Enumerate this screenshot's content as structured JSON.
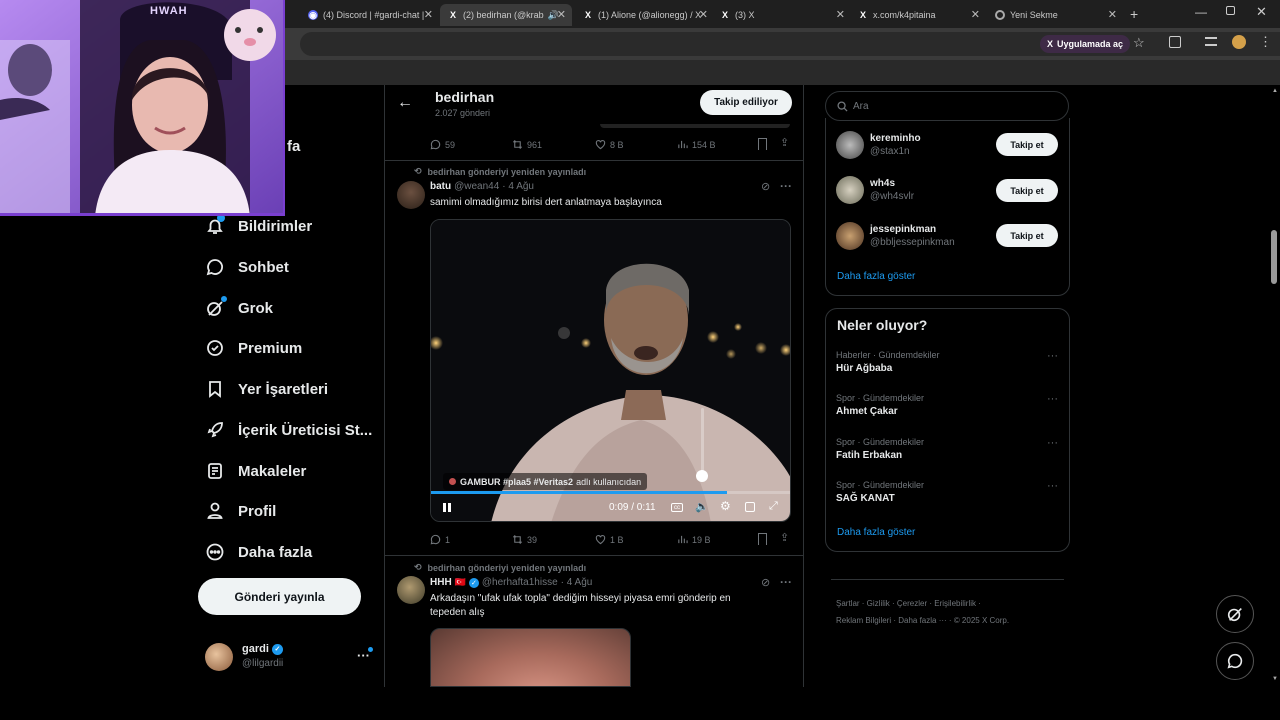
{
  "browser": {
    "tabs": [
      {
        "title": "(4) Discord | #gardi-chat |",
        "icon": "discord-icon"
      },
      {
        "title": "(2) bedirhan (@krab",
        "icon": "x-logo-icon",
        "active": true
      },
      {
        "title": "(1) Alione (@alionegg) / X",
        "icon": "x-logo-icon"
      },
      {
        "title": "(3) X",
        "icon": "x-logo-icon"
      },
      {
        "title": "x.com/k4pitaina",
        "icon": "x-logo-icon"
      },
      {
        "title": "Yeni Sekme",
        "icon": "chrome-icon"
      }
    ],
    "open_in_app": "Uygulamada aç"
  },
  "sidebar": {
    "partial_label": "fa",
    "items": [
      {
        "label": "Bildirimler",
        "icon": "bell-icon"
      },
      {
        "label": "Sohbet",
        "icon": "chat-icon"
      },
      {
        "label": "Grok",
        "icon": "grok-icon"
      },
      {
        "label": "Premium",
        "icon": "premium-icon"
      },
      {
        "label": "Yer İşaretleri",
        "icon": "bookmark-icon"
      },
      {
        "label": "İçerik Üreticisi St...",
        "icon": "rocket-icon"
      },
      {
        "label": "Makaleler",
        "icon": "article-icon"
      },
      {
        "label": "Profil",
        "icon": "person-icon"
      },
      {
        "label": "Daha fazla",
        "icon": "more-circle-icon"
      }
    ],
    "post_button": "Gönderi yayınla",
    "account": {
      "name": "gardi",
      "handle": "@lilgardii"
    }
  },
  "profile_header": {
    "name": "bedirhan",
    "posts_count": "2.027 gönderi",
    "follow_state": "Takip ediliyor"
  },
  "tweets": [
    {
      "stats": {
        "replies": "59",
        "reposts": "961",
        "likes": "8 B",
        "views": "154 B"
      }
    },
    {
      "repost_label": "bedirhan gönderiyi yeniden yayınladı",
      "author": "batu",
      "handle": "@wean44",
      "time": "· 4 Ağu",
      "text": "samimi olmadığımız birisi dert anlatmaya başlayınca",
      "video": {
        "caption_prefix": "GAMBUR #plaa5 #Veritas2",
        "caption_suffix": "adlı kullanıcıdan",
        "time": "0:09 / 0:11",
        "progress": 0.82
      },
      "stats": {
        "replies": "1",
        "reposts": "39",
        "likes": "1 B",
        "views": "19 B"
      }
    },
    {
      "repost_label": "bedirhan gönderiyi yeniden yayınladı",
      "author": "HHH",
      "flag": "🇹🇷",
      "handle": "@herhafta1hisse",
      "time": "· 4 Ağu",
      "text_line1": "Arkadaşın \"ufak ufak topla\" dediğim hisseyi piyasa emri gönderip en",
      "text_line2": "tepeden alış"
    }
  ],
  "search": {
    "placeholder": "Ara"
  },
  "who_to_follow": {
    "accounts": [
      {
        "name": "kereminho",
        "handle": "@stax1n",
        "button": "Takip et"
      },
      {
        "name": "wh4s",
        "handle": "@wh4svlr",
        "button": "Takip et"
      },
      {
        "name": "jessepinkman",
        "handle": "@bbljessepinkman",
        "button": "Takip et"
      }
    ],
    "show_more": "Daha fazla göster"
  },
  "trends": {
    "title": "Neler oluyor?",
    "items": [
      {
        "category": "Haberler · Gündemdekiler",
        "name": "Hür Ağbaba"
      },
      {
        "category": "Spor · Gündemdekiler",
        "name": "Ahmet Çakar"
      },
      {
        "category": "Spor · Gündemdekiler",
        "name": "Fatih Erbakan"
      },
      {
        "category": "Spor · Gündemdekiler",
        "name": "SAĞ KANAT"
      }
    ],
    "show_more": "Daha fazla göster"
  },
  "footer": {
    "links": [
      "Şartlar",
      "Gizlilik",
      "Çerezler",
      "Erişilebilirlik",
      "Reklam Bilgileri",
      "Daha fazla ···",
      "© 2025 X Corp."
    ]
  },
  "webcam": {
    "cap_text": "HWAH"
  },
  "colors": {
    "accent": "#1d9bf0",
    "bg": "#000000",
    "border": "#2f3336",
    "muted": "#71767b",
    "webcam_tint": "#9b5de5"
  }
}
